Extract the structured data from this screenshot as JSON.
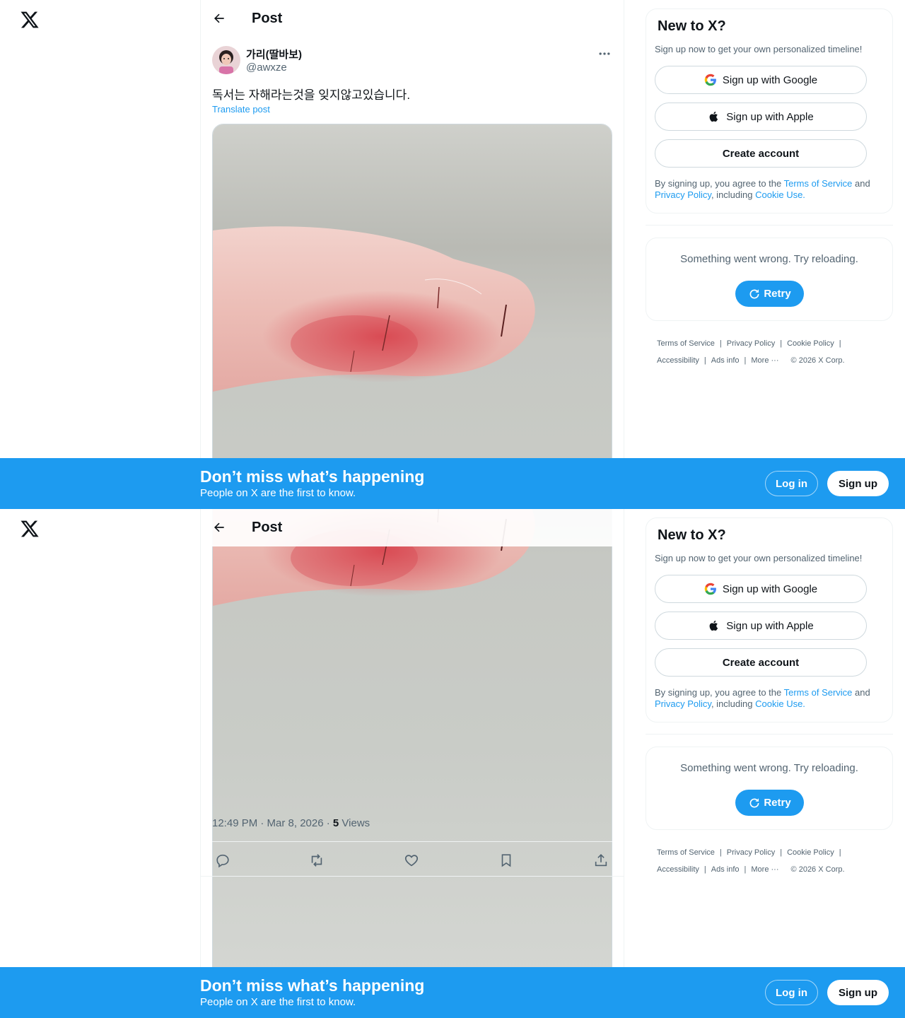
{
  "header": {
    "title": "Post"
  },
  "post": {
    "author_name": "가리(딸바보)",
    "author_handle": "@awxze",
    "text": "독서는 자해라는것을 잊지않고있습니다.",
    "translate_label": "Translate post",
    "time": "12:49 PM · Mar 8, 2026 · ",
    "views_count": "5",
    "views_label": " Views"
  },
  "signup_card": {
    "title": "New to X?",
    "subtitle": "Sign up now to get your own personalized timeline!",
    "google_label": "Sign up with Google",
    "apple_label": "Sign up with Apple",
    "create_label": "Create account",
    "legal_prefix": "By signing up, you agree to the ",
    "terms_link": "Terms of Service",
    "legal_and": " and ",
    "privacy_link": "Privacy Policy",
    "legal_including": ", including ",
    "cookie_link": "Cookie Use."
  },
  "error_card": {
    "message": "Something went wrong. Try reloading.",
    "retry_label": "Retry"
  },
  "footer": {
    "terms": "Terms of Service",
    "privacy": "Privacy Policy",
    "cookie": "Cookie Policy",
    "accessibility": "Accessibility",
    "ads": "Ads info",
    "more": "More ···",
    "copyright": "© 2026 X Corp."
  },
  "banner": {
    "title": "Don’t miss what’s happening",
    "subtitle": "People on X are the first to know.",
    "login_label": "Log in",
    "signup_label": "Sign up"
  },
  "colors": {
    "accent": "#1d9bf0",
    "text": "#0f1419",
    "muted": "#536471"
  }
}
